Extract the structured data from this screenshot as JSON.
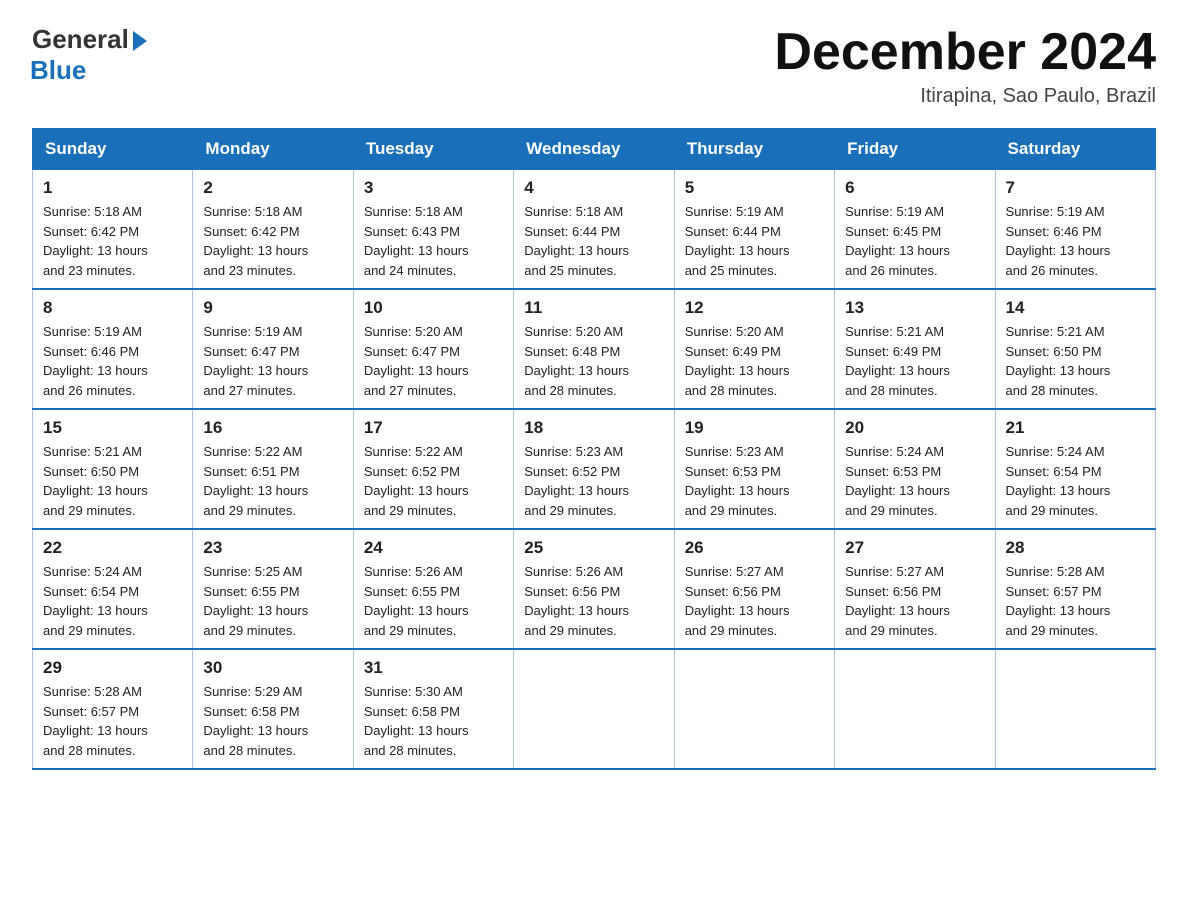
{
  "logo": {
    "general": "General",
    "blue": "Blue"
  },
  "title": "December 2024",
  "location": "Itirapina, Sao Paulo, Brazil",
  "days_of_week": [
    "Sunday",
    "Monday",
    "Tuesday",
    "Wednesday",
    "Thursday",
    "Friday",
    "Saturday"
  ],
  "weeks": [
    [
      {
        "day": "1",
        "sunrise": "5:18 AM",
        "sunset": "6:42 PM",
        "daylight": "13 hours and 23 minutes."
      },
      {
        "day": "2",
        "sunrise": "5:18 AM",
        "sunset": "6:42 PM",
        "daylight": "13 hours and 23 minutes."
      },
      {
        "day": "3",
        "sunrise": "5:18 AM",
        "sunset": "6:43 PM",
        "daylight": "13 hours and 24 minutes."
      },
      {
        "day": "4",
        "sunrise": "5:18 AM",
        "sunset": "6:44 PM",
        "daylight": "13 hours and 25 minutes."
      },
      {
        "day": "5",
        "sunrise": "5:19 AM",
        "sunset": "6:44 PM",
        "daylight": "13 hours and 25 minutes."
      },
      {
        "day": "6",
        "sunrise": "5:19 AM",
        "sunset": "6:45 PM",
        "daylight": "13 hours and 26 minutes."
      },
      {
        "day": "7",
        "sunrise": "5:19 AM",
        "sunset": "6:46 PM",
        "daylight": "13 hours and 26 minutes."
      }
    ],
    [
      {
        "day": "8",
        "sunrise": "5:19 AM",
        "sunset": "6:46 PM",
        "daylight": "13 hours and 26 minutes."
      },
      {
        "day": "9",
        "sunrise": "5:19 AM",
        "sunset": "6:47 PM",
        "daylight": "13 hours and 27 minutes."
      },
      {
        "day": "10",
        "sunrise": "5:20 AM",
        "sunset": "6:47 PM",
        "daylight": "13 hours and 27 minutes."
      },
      {
        "day": "11",
        "sunrise": "5:20 AM",
        "sunset": "6:48 PM",
        "daylight": "13 hours and 28 minutes."
      },
      {
        "day": "12",
        "sunrise": "5:20 AM",
        "sunset": "6:49 PM",
        "daylight": "13 hours and 28 minutes."
      },
      {
        "day": "13",
        "sunrise": "5:21 AM",
        "sunset": "6:49 PM",
        "daylight": "13 hours and 28 minutes."
      },
      {
        "day": "14",
        "sunrise": "5:21 AM",
        "sunset": "6:50 PM",
        "daylight": "13 hours and 28 minutes."
      }
    ],
    [
      {
        "day": "15",
        "sunrise": "5:21 AM",
        "sunset": "6:50 PM",
        "daylight": "13 hours and 29 minutes."
      },
      {
        "day": "16",
        "sunrise": "5:22 AM",
        "sunset": "6:51 PM",
        "daylight": "13 hours and 29 minutes."
      },
      {
        "day": "17",
        "sunrise": "5:22 AM",
        "sunset": "6:52 PM",
        "daylight": "13 hours and 29 minutes."
      },
      {
        "day": "18",
        "sunrise": "5:23 AM",
        "sunset": "6:52 PM",
        "daylight": "13 hours and 29 minutes."
      },
      {
        "day": "19",
        "sunrise": "5:23 AM",
        "sunset": "6:53 PM",
        "daylight": "13 hours and 29 minutes."
      },
      {
        "day": "20",
        "sunrise": "5:24 AM",
        "sunset": "6:53 PM",
        "daylight": "13 hours and 29 minutes."
      },
      {
        "day": "21",
        "sunrise": "5:24 AM",
        "sunset": "6:54 PM",
        "daylight": "13 hours and 29 minutes."
      }
    ],
    [
      {
        "day": "22",
        "sunrise": "5:24 AM",
        "sunset": "6:54 PM",
        "daylight": "13 hours and 29 minutes."
      },
      {
        "day": "23",
        "sunrise": "5:25 AM",
        "sunset": "6:55 PM",
        "daylight": "13 hours and 29 minutes."
      },
      {
        "day": "24",
        "sunrise": "5:26 AM",
        "sunset": "6:55 PM",
        "daylight": "13 hours and 29 minutes."
      },
      {
        "day": "25",
        "sunrise": "5:26 AM",
        "sunset": "6:56 PM",
        "daylight": "13 hours and 29 minutes."
      },
      {
        "day": "26",
        "sunrise": "5:27 AM",
        "sunset": "6:56 PM",
        "daylight": "13 hours and 29 minutes."
      },
      {
        "day": "27",
        "sunrise": "5:27 AM",
        "sunset": "6:56 PM",
        "daylight": "13 hours and 29 minutes."
      },
      {
        "day": "28",
        "sunrise": "5:28 AM",
        "sunset": "6:57 PM",
        "daylight": "13 hours and 29 minutes."
      }
    ],
    [
      {
        "day": "29",
        "sunrise": "5:28 AM",
        "sunset": "6:57 PM",
        "daylight": "13 hours and 28 minutes."
      },
      {
        "day": "30",
        "sunrise": "5:29 AM",
        "sunset": "6:58 PM",
        "daylight": "13 hours and 28 minutes."
      },
      {
        "day": "31",
        "sunrise": "5:30 AM",
        "sunset": "6:58 PM",
        "daylight": "13 hours and 28 minutes."
      },
      null,
      null,
      null,
      null
    ]
  ]
}
